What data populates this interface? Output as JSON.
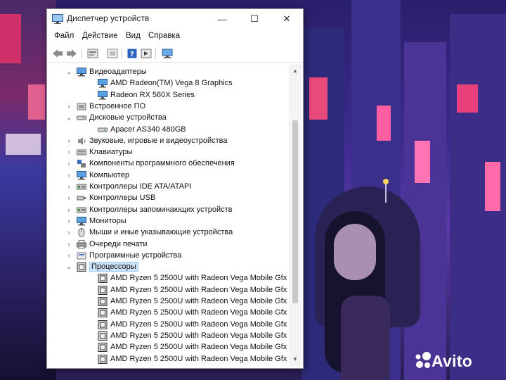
{
  "window": {
    "title": "Диспетчер устройств",
    "controls": {
      "minimize": "—",
      "maximize": "☐",
      "close": "✕"
    }
  },
  "menubar": {
    "items": [
      "Файл",
      "Действие",
      "Вид",
      "Справка"
    ]
  },
  "toolbar": {
    "buttons": [
      "back-icon",
      "forward-icon",
      "properties-icon",
      "show-hidden-icon",
      "help-icon",
      "run-icon",
      "monitor-icon"
    ]
  },
  "tree": {
    "rows": [
      {
        "label": "Видеоадаптеры",
        "level": 0,
        "expanded": true,
        "icon": "display-adapter-icon"
      },
      {
        "label": "AMD Radeon(TM) Vega 8 Graphics",
        "level": 1,
        "icon": "display-adapter-icon"
      },
      {
        "label": "Radeon RX 560X Series",
        "level": 1,
        "icon": "display-adapter-icon"
      },
      {
        "label": "Встроенное ПО",
        "level": 0,
        "expanded": false,
        "icon": "firmware-icon"
      },
      {
        "label": "Дисковые устройства",
        "level": 0,
        "expanded": true,
        "icon": "disk-icon"
      },
      {
        "label": "Apacer AS340 480GB",
        "level": 1,
        "icon": "disk-icon"
      },
      {
        "label": "Звуковые, игровые и видеоустройства",
        "level": 0,
        "expanded": false,
        "icon": "speaker-icon"
      },
      {
        "label": "Клавиатуры",
        "level": 0,
        "expanded": false,
        "icon": "keyboard-icon"
      },
      {
        "label": "Компоненты программного обеспечения",
        "level": 0,
        "expanded": false,
        "icon": "software-component-icon"
      },
      {
        "label": "Компьютер",
        "level": 0,
        "expanded": false,
        "icon": "computer-icon"
      },
      {
        "label": "Контроллеры IDE ATA/ATAPI",
        "level": 0,
        "expanded": false,
        "icon": "ide-controller-icon"
      },
      {
        "label": "Контроллеры USB",
        "level": 0,
        "expanded": false,
        "icon": "usb-icon"
      },
      {
        "label": "Контроллеры запоминающих устройств",
        "level": 0,
        "expanded": false,
        "icon": "storage-controller-icon"
      },
      {
        "label": "Мониторы",
        "level": 0,
        "expanded": false,
        "icon": "monitor-icon"
      },
      {
        "label": "Мыши и иные указывающие устройства",
        "level": 0,
        "expanded": false,
        "icon": "mouse-icon"
      },
      {
        "label": "Очереди печати",
        "level": 0,
        "expanded": false,
        "icon": "printer-icon"
      },
      {
        "label": "Программные устройства",
        "level": 0,
        "expanded": false,
        "icon": "software-device-icon"
      },
      {
        "label": "Процессоры",
        "level": 0,
        "expanded": true,
        "icon": "processor-icon",
        "selected": true
      },
      {
        "label": "AMD Ryzen 5 2500U with Radeon Vega Mobile Gfx",
        "level": 1,
        "icon": "processor-icon"
      },
      {
        "label": "AMD Ryzen 5 2500U with Radeon Vega Mobile Gfx",
        "level": 1,
        "icon": "processor-icon"
      },
      {
        "label": "AMD Ryzen 5 2500U with Radeon Vega Mobile Gfx",
        "level": 1,
        "icon": "processor-icon"
      },
      {
        "label": "AMD Ryzen 5 2500U with Radeon Vega Mobile Gfx",
        "level": 1,
        "icon": "processor-icon"
      },
      {
        "label": "AMD Ryzen 5 2500U with Radeon Vega Mobile Gfx",
        "level": 1,
        "icon": "processor-icon"
      },
      {
        "label": "AMD Ryzen 5 2500U with Radeon Vega Mobile Gfx",
        "level": 1,
        "icon": "processor-icon"
      },
      {
        "label": "AMD Ryzen 5 2500U with Radeon Vega Mobile Gfx",
        "level": 1,
        "icon": "processor-icon"
      },
      {
        "label": "AMD Ryzen 5 2500U with Radeon Vega Mobile Gfx",
        "level": 1,
        "icon": "processor-icon"
      }
    ]
  },
  "watermark": {
    "text": "Avito"
  },
  "colors": {
    "selection": "#cde3f7",
    "selection_border": "#99c9ef",
    "accent": "#0078d7"
  }
}
